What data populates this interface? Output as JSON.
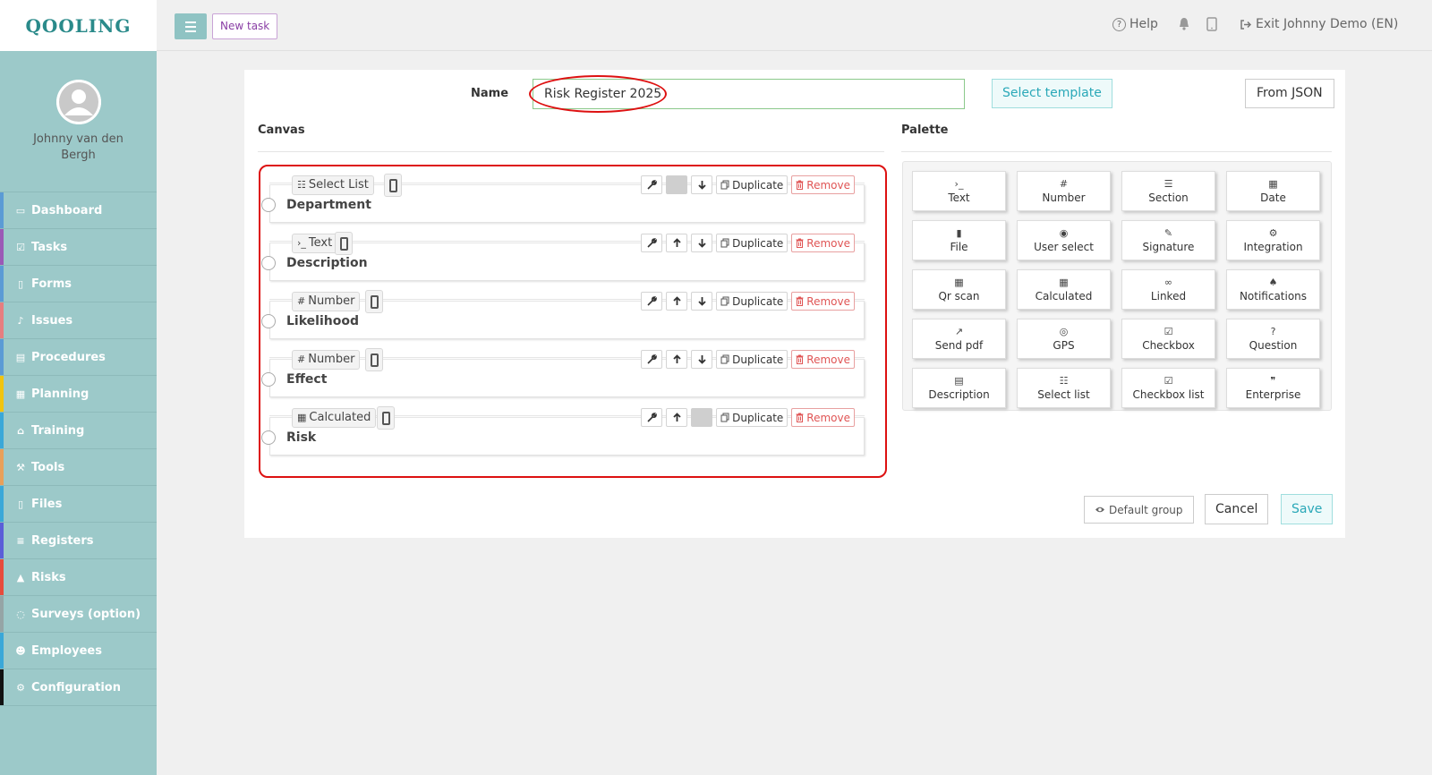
{
  "brand": {
    "logo_text": "QOOLING"
  },
  "user": {
    "name": "Johnny van den Bergh"
  },
  "nav": [
    {
      "label": "Dashboard",
      "icon": "monitor-icon",
      "glyph": "▭",
      "color": "#5b9bd5"
    },
    {
      "label": "Tasks",
      "icon": "check-square-icon",
      "glyph": "☑",
      "color": "#9b59b6"
    },
    {
      "label": "Forms",
      "icon": "file-icon",
      "glyph": "▯",
      "color": "#5b9bd5"
    },
    {
      "label": "Issues",
      "icon": "bell-icon",
      "glyph": "♪",
      "color": "#e67e80"
    },
    {
      "label": "Procedures",
      "icon": "book-icon",
      "glyph": "▤",
      "color": "#5b9bd5"
    },
    {
      "label": "Planning",
      "icon": "calendar-icon",
      "glyph": "▦",
      "color": "#f1c40f"
    },
    {
      "label": "Training",
      "icon": "graduation-cap-icon",
      "glyph": "⌂",
      "color": "#3aa8d8"
    },
    {
      "label": "Tools",
      "icon": "wrench-icon",
      "glyph": "⚒",
      "color": "#e8a05a"
    },
    {
      "label": "Files",
      "icon": "pdf-file-icon",
      "glyph": "▯",
      "color": "#3aa8d8"
    },
    {
      "label": "Registers",
      "icon": "list-icon",
      "glyph": "≡",
      "color": "#5b5ed8"
    },
    {
      "label": "Risks",
      "icon": "warning-icon",
      "glyph": "▲",
      "color": "#e74c3c"
    },
    {
      "label": "Surveys (option)",
      "icon": "comment-icon",
      "glyph": "◌",
      "color": "#95a5a6"
    },
    {
      "label": "Employees",
      "icon": "users-icon",
      "glyph": "☻",
      "color": "#3aa8d8"
    },
    {
      "label": "Configuration",
      "icon": "gear-icon",
      "glyph": "⚙",
      "color": "#111111"
    }
  ],
  "topbar": {
    "new_task": "New task",
    "help": "Help",
    "exit": "Exit Johnny Demo (EN)"
  },
  "form": {
    "name_label": "Name",
    "name_value": "Risk Register 2025",
    "select_template": "Select template",
    "from_json": "From JSON",
    "canvas_title": "Canvas",
    "palette_title": "Palette",
    "default_group": "Default group",
    "cancel": "Cancel",
    "save": "Save"
  },
  "canvas_fields": [
    {
      "type": "Select List",
      "type_icon": "list-ol-icon",
      "glyph": "☷",
      "label": "Department",
      "up_enabled": false,
      "down_enabled": true
    },
    {
      "type": "Text",
      "type_icon": "terminal-icon",
      "glyph": "›_",
      "label": "Description",
      "up_enabled": true,
      "down_enabled": true
    },
    {
      "type": "Number",
      "type_icon": "hash-icon",
      "glyph": "#",
      "label": "Likelihood",
      "up_enabled": true,
      "down_enabled": true
    },
    {
      "type": "Number",
      "type_icon": "hash-icon",
      "glyph": "#",
      "label": "Effect",
      "up_enabled": true,
      "down_enabled": true
    },
    {
      "type": "Calculated",
      "type_icon": "calculator-icon",
      "glyph": "▦",
      "label": "Risk",
      "up_enabled": true,
      "down_enabled": false
    }
  ],
  "field_actions": {
    "duplicate": "Duplicate",
    "remove": "Remove"
  },
  "palette": [
    {
      "label": "Text",
      "icon": "terminal-icon",
      "glyph": "›_"
    },
    {
      "label": "Number",
      "icon": "hash-icon",
      "glyph": "#"
    },
    {
      "label": "Section",
      "icon": "list-icon",
      "glyph": "☰"
    },
    {
      "label": "Date",
      "icon": "calendar-icon",
      "glyph": "▦"
    },
    {
      "label": "File",
      "icon": "file-icon",
      "glyph": "▮"
    },
    {
      "label": "User select",
      "icon": "user-circle-icon",
      "glyph": "◉"
    },
    {
      "label": "Signature",
      "icon": "signature-icon",
      "glyph": "✎"
    },
    {
      "label": "Integration",
      "icon": "cogs-icon",
      "glyph": "⚙"
    },
    {
      "label": "Qr scan",
      "icon": "qrcode-icon",
      "glyph": "▦"
    },
    {
      "label": "Calculated",
      "icon": "calculator-icon",
      "glyph": "▦"
    },
    {
      "label": "Linked",
      "icon": "link-icon",
      "glyph": "∞"
    },
    {
      "label": "Notifications",
      "icon": "bell-icon",
      "glyph": "♠"
    },
    {
      "label": "Send pdf",
      "icon": "share-icon",
      "glyph": "↗"
    },
    {
      "label": "GPS",
      "icon": "compass-icon",
      "glyph": "◎"
    },
    {
      "label": "Checkbox",
      "icon": "check-square-icon",
      "glyph": "☑"
    },
    {
      "label": "Question",
      "icon": "question-circle-icon",
      "glyph": "?"
    },
    {
      "label": "Description",
      "icon": "file-text-icon",
      "glyph": "▤"
    },
    {
      "label": "Select list",
      "icon": "list-ol-icon",
      "glyph": "☷"
    },
    {
      "label": "Checkbox list",
      "icon": "check-square-icon",
      "glyph": "☑"
    },
    {
      "label": "Enterprise",
      "icon": "quote-icon",
      "glyph": "❞"
    }
  ]
}
